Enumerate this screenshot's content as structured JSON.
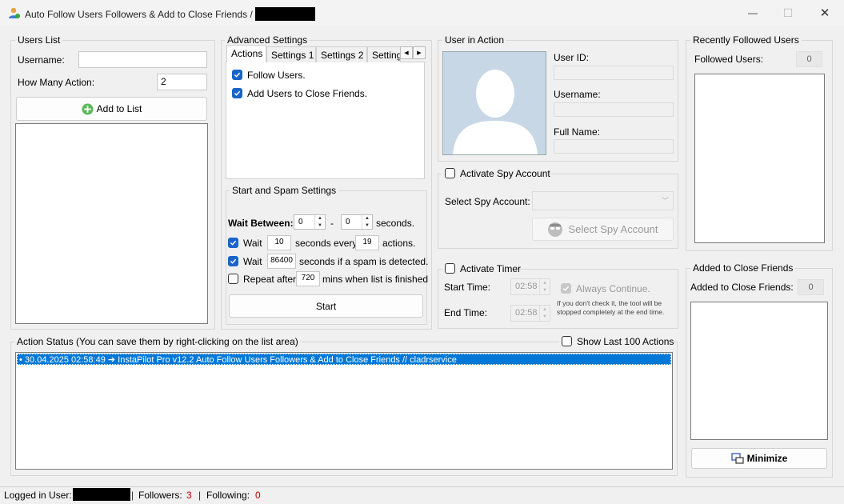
{
  "window": {
    "title": "Auto Follow Users Followers & Add to Close Friends /",
    "minimize_glyph": "—",
    "maximize_glyph": "☐",
    "close_glyph": "✕"
  },
  "users_list": {
    "group_title": "Users List",
    "username_label": "Username:",
    "username_value": "",
    "how_many_label": "How Many Action:",
    "how_many_value": "2",
    "add_button": "Add to List"
  },
  "advanced": {
    "group_title": "Advanced Settings",
    "tabs": [
      "Actions",
      "Settings 1",
      "Settings 2",
      "Setting"
    ],
    "follow_users": "Follow Users.",
    "add_close_friends": "Add Users to Close Friends."
  },
  "spam": {
    "group_title": "Start and Spam Settings",
    "wait_between_label": "Wait Between:",
    "wait_min": "0",
    "dash": "-",
    "wait_max": "0",
    "seconds_label": "seconds.",
    "wait1_label": "Wait",
    "wait1_value": "10",
    "seconds_every_label": "seconds every",
    "every_value": "19",
    "actions_label": "actions.",
    "wait2_label": "Wait",
    "wait2_value": "86400",
    "spam_label": "seconds if a spam is detected.",
    "repeat_label": "Repeat after",
    "repeat_value": "720",
    "repeat_suffix": "mins when list is finished",
    "start_button": "Start"
  },
  "user_in_action": {
    "group_title": "User in Action",
    "user_id_label": "User ID:",
    "username_label": "Username:",
    "full_name_label": "Full Name:"
  },
  "spy": {
    "activate_label": "Activate Spy Account",
    "select_label": "Select Spy Account:",
    "select_button": "Select Spy Account"
  },
  "timer": {
    "activate_label": "Activate Timer",
    "start_label": "Start Time:",
    "start_value": "02:58",
    "end_label": "End Time:",
    "end_value": "02:58",
    "always_continue": "Always Continue.",
    "note": "If you don't check it, the tool will be stopped completely at the end time."
  },
  "recently": {
    "group_title": "Recently Followed Users",
    "followed_label": "Followed Users:",
    "followed_count": "0"
  },
  "close_friends": {
    "group_title": "Added to Close Friends",
    "label": "Added to Close Friends:",
    "count": "0",
    "minimize_button": "Minimize"
  },
  "action_status": {
    "group_title": "Action Status (You can save them by right-clicking on the list area)",
    "show_last": "Show Last 100 Actions",
    "entries": [
      "• 30.04.2025 02:58:49 ➔ InstaPilot Pro v12.2 Auto Follow Users Followers & Add to Close Friends // cladrservice"
    ]
  },
  "status_bar": {
    "logged_label": "Logged in User:",
    "sep1": "|",
    "followers_label": "Followers:",
    "followers_value": "3",
    "sep2": "|",
    "following_label": "Following:",
    "following_value": "0"
  },
  "colors": {
    "accent": "#1a64c8",
    "selection": "#0078d7",
    "status_value": "#c00000"
  }
}
